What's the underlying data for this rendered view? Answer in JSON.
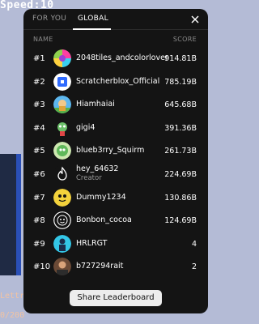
{
  "hud": {
    "speed": "Speed:10"
  },
  "background": {
    "text_line_1": "Lettr",
    "text_line_2": "0/200"
  },
  "tabs": [
    {
      "label": "FOR YOU",
      "active": false
    },
    {
      "label": "GLOBAL",
      "active": true
    }
  ],
  "columns": {
    "name": "NAME",
    "score": "SCORE"
  },
  "rows": [
    {
      "rank": "#1",
      "name": "2048tiles_andcolorlover",
      "subtitle": "",
      "score": "914.81B",
      "avatar": "rainbow-swirl"
    },
    {
      "rank": "#2",
      "name": "Scratcherblox_Official",
      "subtitle": "",
      "score": "785.19B",
      "avatar": "blue-square-logo"
    },
    {
      "rank": "#3",
      "name": "Hiamhaiai",
      "subtitle": "",
      "score": "645.68B",
      "avatar": "character-on-sky"
    },
    {
      "rank": "#4",
      "name": "gigi4",
      "subtitle": "",
      "score": "391.36B",
      "avatar": "green-creature"
    },
    {
      "rank": "#5",
      "name": "blueb3rry_Squirm",
      "subtitle": "",
      "score": "261.73B",
      "avatar": "green-art"
    },
    {
      "rank": "#6",
      "name": "hey_64632",
      "subtitle": "Creator",
      "score": "224.69B",
      "avatar": "flame-icon"
    },
    {
      "rank": "#7",
      "name": "Dummy1234",
      "subtitle": "",
      "score": "130.86B",
      "avatar": "yellow-face"
    },
    {
      "rank": "#8",
      "name": "Bonbon_cocoa",
      "subtitle": "",
      "score": "124.69B",
      "avatar": "line-drawing-face"
    },
    {
      "rank": "#9",
      "name": "HRLRGT",
      "subtitle": "",
      "score": "4",
      "avatar": "cyan-figure"
    },
    {
      "rank": "#10",
      "name": "b727294rait",
      "subtitle": "",
      "score": "2",
      "avatar": "photo-avatar"
    }
  ],
  "share_button": {
    "label": "Share Leaderboard"
  }
}
